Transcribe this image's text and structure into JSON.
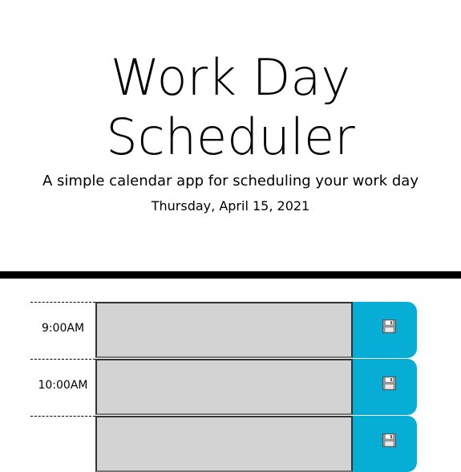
{
  "header": {
    "title": "Work Day Scheduler",
    "title_line1": "Work Day",
    "title_line2": "Scheduler",
    "subtitle": "A simple calendar app for scheduling your work day",
    "current_day": "Thursday, April 15, 2021"
  },
  "schedule": {
    "rows": [
      {
        "hour": "9:00AM",
        "task": ""
      },
      {
        "hour": "10:00AM",
        "task": ""
      },
      {
        "hour": "",
        "task": ""
      }
    ],
    "save_icon": "floppy-disk-icon"
  },
  "colors": {
    "save_button": "#06aed5",
    "textarea_bg": "#d3d3d3",
    "divider": "#000000"
  }
}
